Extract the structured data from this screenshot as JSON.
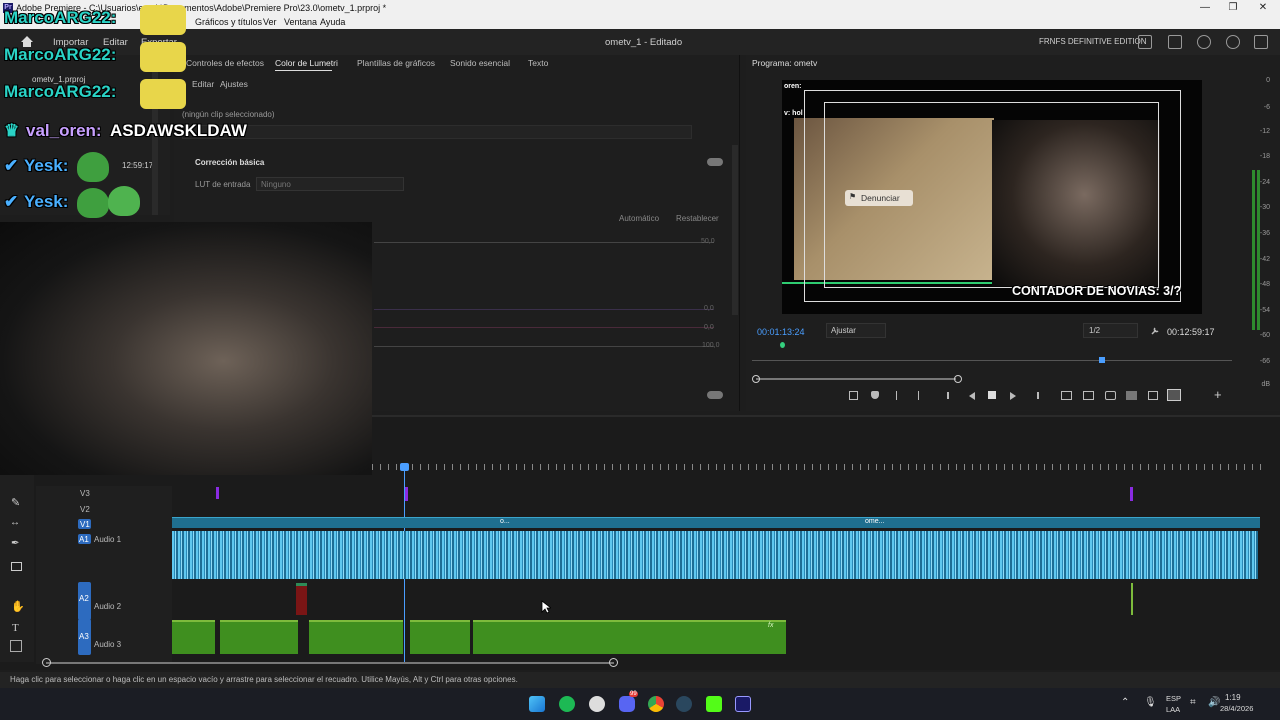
{
  "window": {
    "title": "Adobe Premiere - C:\\Usuarios\\esteb\\Documentos\\Adobe\\Premiere Pro\\23.0\\ometv_1.prproj *",
    "app_badge": "Pr",
    "minimize": "—",
    "maximize": "❐",
    "close": "✕"
  },
  "menu": [
    "Gráficos y títulos",
    "Ver",
    "Ventana",
    "Ayuda"
  ],
  "header": {
    "home_icon": "home-icon",
    "items": [
      "Importar",
      "Editar",
      "Exportar"
    ],
    "project_title": "ometv_1 - Editado",
    "workspace": "FRNFS DEFINITIVE EDITION"
  },
  "project_panel": {
    "file_name": "ometv_1.prproj",
    "clip_time": "12:59:17"
  },
  "chat": {
    "lines": [
      {
        "user": "MarcoARG22:",
        "color": "#2ad3c6"
      },
      {
        "user": "MarcoARG22:",
        "color": "#2ad3c6"
      },
      {
        "user": "MarcoARG22:",
        "color": "#2ad3c6"
      }
    ],
    "val_user": "val_oren:",
    "val_message": "ASDAWSKLDAW",
    "yesk1": "Yesk:",
    "yesk2": "Yesk:"
  },
  "lumetri": {
    "tabs": [
      "Controles de efectos",
      "Color de Lumetri",
      "Plantillas de gráficos",
      "Sonido esencial",
      "Texto"
    ],
    "subtabs": [
      "Editar",
      "Ajustes"
    ],
    "no_clip": "(ningún clip seleccionado)",
    "section": "Corrección básica",
    "lut_label": "LUT de entrada",
    "lut_value": "Ninguno",
    "auto": "Automático",
    "reset": "Restablecer",
    "slider_values": [
      "50,0",
      "0,0",
      "0,0",
      "100,0"
    ]
  },
  "program": {
    "title": "Programa: ometv",
    "current_time": "00:01:13:24",
    "fit": "Ajustar",
    "resolution": "1/2",
    "duration": "00:12:59:17",
    "overlay_text": "CONTADOR DE NOVIAS: 3/?",
    "report_label": "Denunciar",
    "chat_snippets": [
      "oren:",
      "v: hol"
    ],
    "meter_labels": [
      "0",
      "-6",
      "-12",
      "-18",
      "-24",
      "-30",
      "-36",
      "-42",
      "-48",
      "-54",
      "-60",
      "-66",
      "dB"
    ]
  },
  "timeline": {
    "tracks_video": [
      "V3",
      "V2",
      "V1"
    ],
    "tracks_audio": [
      {
        "id": "A1",
        "name": "Audio 1"
      },
      {
        "id": "A2",
        "name": "Audio 2"
      },
      {
        "id": "A3",
        "name": "Audio 3"
      }
    ],
    "clip_labels": [
      "o...",
      "ome..."
    ],
    "fx": "fx"
  },
  "status": "Haga clic para seleccionar o haga clic en un espacio vacío y arrastre para seleccionar el recuadro. Utilice Mayús, Alt y Ctrl para otras opciones.",
  "taskbar": {
    "lang1": "ESP",
    "lang2": "LAA",
    "time": "1:19",
    "date": "28/4/2026",
    "icons": [
      "windows-icon",
      "spotify-icon",
      "chrome-alt-icon",
      "discord-icon",
      "chrome-icon",
      "steam-icon",
      "kick-icon",
      "premiere-icon"
    ],
    "discord_badge": "99"
  }
}
